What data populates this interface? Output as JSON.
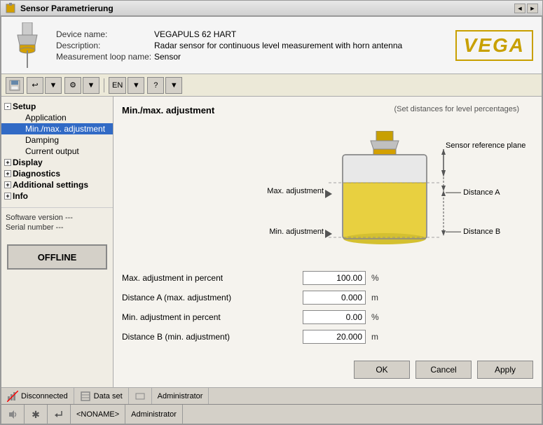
{
  "titleBar": {
    "title": "Sensor Parametrierung",
    "controls": [
      "◄",
      "►",
      "✕"
    ]
  },
  "deviceHeader": {
    "deviceNameLabel": "Device name:",
    "deviceNameValue": "VEGAPULS 62 HART",
    "descriptionLabel": "Description:",
    "descriptionValue": "Radar sensor for continuous level measurement with horn antenna",
    "measurementLoopLabel": "Measurement loop name:",
    "measurementLoopValue": "Sensor",
    "logoText": "VEGA"
  },
  "toolbar": {
    "buttons": [
      "⊡",
      "↩",
      "⚙",
      "EN",
      "?"
    ]
  },
  "sidebar": {
    "tree": [
      {
        "label": "Setup",
        "level": 0,
        "expanded": true,
        "icon": "-"
      },
      {
        "label": "Application",
        "level": 2,
        "selected": false
      },
      {
        "label": "Min./max. adjustment",
        "level": 2,
        "selected": true
      },
      {
        "label": "Damping",
        "level": 2,
        "selected": false
      },
      {
        "label": "Current output",
        "level": 2,
        "selected": false
      },
      {
        "label": "Display",
        "level": 0,
        "expanded": false,
        "icon": "+"
      },
      {
        "label": "Diagnostics",
        "level": 0,
        "expanded": false,
        "icon": "+"
      },
      {
        "label": "Additional settings",
        "level": 0,
        "expanded": false,
        "icon": "+"
      },
      {
        "label": "Info",
        "level": 0,
        "expanded": false,
        "icon": "+"
      }
    ],
    "softwareVersion": "Software version   ---",
    "serialNumber": "Serial number        ---",
    "offlineButton": "OFFLINE"
  },
  "mainPanel": {
    "title": "Min./max. adjustment",
    "subtitle": "(Set distances for level percentages)",
    "labels": {
      "maxAdjustment": "Max. adjustment",
      "minAdjustment": "Min. adjustment",
      "sensorReferencePlane": "Sensor reference plane",
      "distanceA": "Distance A",
      "distanceB": "Distance B"
    },
    "fields": [
      {
        "label": "Max. adjustment in percent",
        "value": "100.00",
        "unit": "%"
      },
      {
        "label": "Distance A (max. adjustment)",
        "value": "0.000",
        "unit": "m"
      },
      {
        "label": "Min. adjustment in percent",
        "value": "0.00",
        "unit": "%"
      },
      {
        "label": "Distance B (min. adjustment)",
        "value": "20.000",
        "unit": "m"
      }
    ],
    "buttons": {
      "ok": "OK",
      "cancel": "Cancel",
      "apply": "Apply"
    }
  },
  "statusBar": {
    "disconnected": "Disconnected",
    "dataSet": "Data set",
    "administrator": "Administrator"
  },
  "taskbar": {
    "noname": "<NONAME>",
    "administrator": "Administrator"
  }
}
